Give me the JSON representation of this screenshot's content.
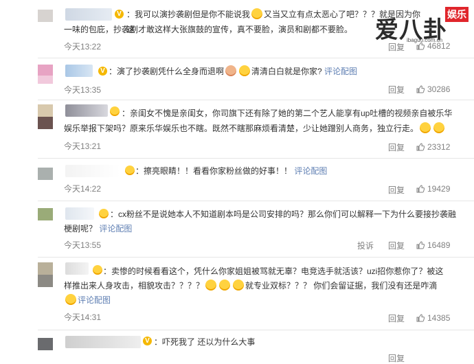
{
  "watermark": {
    "brand": "爱八卦",
    "tag": "娱乐",
    "url": "ibaguo.com.cn"
  },
  "comments": [
    {
      "text_a": "：我可以演抄袭剧但是你不能说我",
      "text_b": "又当又立有点太恶心了吧？？？就是因为你这",
      "text_c": "一味的包庇，抄袭剧才敢这样大张旗鼓的宣传，真不要脸，演员和剧都不要脸。",
      "time": "今天13:22",
      "reply": "回复",
      "likes": "46812"
    },
    {
      "text_a": "：演了抄袭剧凭什么全身而退啊",
      "text_b": "清清白白就是你家?",
      "action": "评论配图",
      "time": "今天13:35",
      "reply": "回复",
      "likes": "30286"
    },
    {
      "text_a": "：亲闺女不愧是亲闺女，你司旗下还有除了她的第二个艺人能享有up吐槽的视频亲自被乐华",
      "text_b": "娱乐举报下架吗？原来乐华娱乐也不瞎。既然不瞎那麻烦看清楚，少让她蹭别人商务，独立行走。",
      "time": "今天13:21",
      "reply": "回复",
      "likes": "23312"
    },
    {
      "text_a": "：擦亮眼睛！！看看你家粉丝做的好事！！",
      "action": "评论配图",
      "time": "今天14:22",
      "reply": "回复",
      "likes": "19429"
    },
    {
      "text_a": "：cx粉丝不是说她本人不知道剧本吗是公司安排的吗？那么你们可以解释一下为什么要接抄袭融",
      "text_b": "梗剧呢？",
      "action": "评论配图",
      "time": "今天13:55",
      "report": "投诉",
      "reply": "回复",
      "likes": "16489"
    },
    {
      "text_a": "：卖惨的时候看看这个，凭什么你家姐姐被骂就无辜？电竞选手就活该？uzi招你惹你了？被这",
      "text_b": "样推出来人身攻击，相貌攻击？？？？",
      "text_c": "就专业双标？？？ 你们会留证据，我们没有还是咋滴",
      "action": "评论配图",
      "time": "今天14:31",
      "reply": "回复",
      "likes": "14385"
    },
    {
      "text_a": "：吓死我了 还以为什么大事",
      "reply": "回复"
    }
  ],
  "colors": {
    "link": "#5f7fb3",
    "muted": "#808080",
    "vip": "#f5b800",
    "tag_bg": "#e0262c"
  },
  "icons": [
    "thumb-up-icon",
    "emoji-icon",
    "vip-badge-icon"
  ]
}
